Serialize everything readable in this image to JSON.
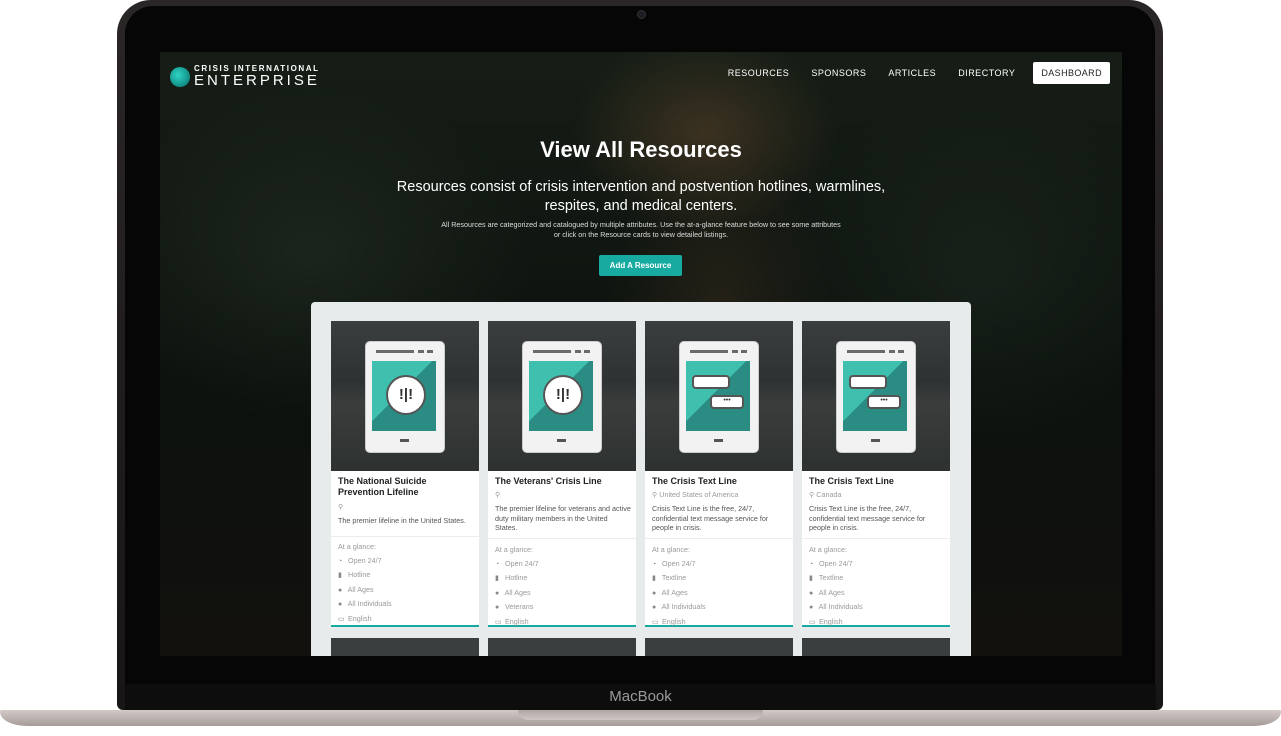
{
  "device": {
    "label": "MacBook"
  },
  "nav": {
    "logo_top": "CRISIS INTERNATIONAL",
    "logo_bottom": "ENTERPRISE",
    "links": [
      "RESOURCES",
      "SPONSORS",
      "ARTICLES",
      "DIRECTORY"
    ],
    "cta": "DASHBOARD"
  },
  "hero": {
    "title": "View All Resources",
    "subtitle": "Resources consist of crisis intervention and postvention hotlines, warmlines, respites, and medical centers.",
    "description": "All Resources are categorized and catalogued by multiple attributes. Use the at-a-glance feature below to see some attributes or click on the Resource cards to view detailed listings.",
    "add_button": "Add A Resource"
  },
  "cards": [
    {
      "title": "The National Suicide Prevention Lifeline",
      "location": "",
      "description": "The premier lifeline in the United States.",
      "glance_label": "At a glance:",
      "hours": "Open 24/7",
      "type": "Hotline",
      "ages": "All Ages",
      "audience": "All Individuals",
      "language": "English",
      "icon": "alert-bubble-icon"
    },
    {
      "title": "The Veterans' Crisis Line",
      "location": "",
      "description": "The premier lifeline for veterans and active duty military members in the United States.",
      "glance_label": "At a glance:",
      "hours": "Open 24/7",
      "type": "Hotline",
      "ages": "All Ages",
      "audience": "Veterans",
      "language": "English",
      "icon": "alert-bubble-icon"
    },
    {
      "title": "The Crisis Text Line",
      "location": "United States of America",
      "description": "Crisis Text Line is the free, 24/7, confidential text message service for people in crisis.",
      "glance_label": "At a glance:",
      "hours": "Open 24/7",
      "type": "Textline",
      "ages": "All Ages",
      "audience": "All Individuals",
      "language": "English",
      "icon": "text-message-icon"
    },
    {
      "title": "The Crisis Text Line",
      "location": "Canada",
      "description": "Crisis Text Line is the free, 24/7, confidential text message service for people in crisis.",
      "glance_label": "At a glance:",
      "hours": "Open 24/7",
      "type": "Textline",
      "ages": "All Ages",
      "audience": "All Individuals",
      "language": "English",
      "icon": "text-message-icon"
    }
  ],
  "colors": {
    "accent": "#17aaa0",
    "panel": "#e7ebec"
  }
}
